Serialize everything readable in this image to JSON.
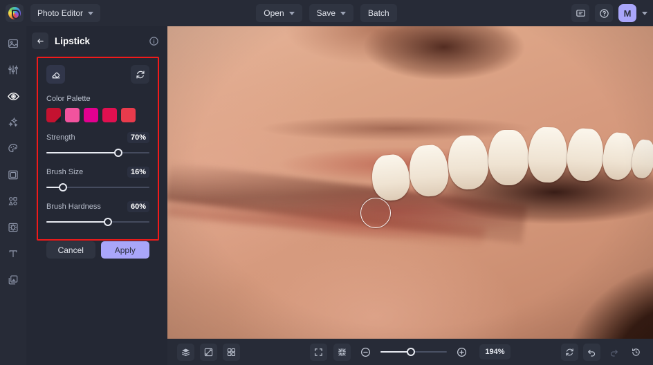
{
  "app": {
    "logo_icon": "color-wheel-logo-icon",
    "switcher_label": "Photo Editor",
    "switcher_chevron_icon": "chevron-down-icon"
  },
  "topbar": {
    "buttons": [
      {
        "label": "Open",
        "icon": "chevron-down-icon",
        "has_chevron": true
      },
      {
        "label": "Save",
        "icon": "chevron-down-icon",
        "has_chevron": true
      },
      {
        "label": "Batch",
        "has_chevron": false
      }
    ],
    "feedback_icon": "chat-bubble-icon",
    "help_icon": "question-circle-icon",
    "avatar_initial": "M",
    "avatar_color": "#a9a6fa",
    "avatar_chevron_icon": "chevron-down-icon"
  },
  "rail": {
    "items": [
      {
        "name": "sidebar-item-image",
        "icon": "image-icon",
        "active": false
      },
      {
        "name": "sidebar-item-adjust",
        "icon": "sliders-icon",
        "active": false
      },
      {
        "name": "sidebar-item-retouch",
        "icon": "eye-icon",
        "active": true
      },
      {
        "name": "sidebar-item-effects",
        "icon": "sparkles-icon",
        "active": false
      },
      {
        "name": "sidebar-item-color",
        "icon": "palette-icon",
        "active": false
      },
      {
        "name": "sidebar-item-frame",
        "icon": "frame-icon",
        "active": false
      },
      {
        "name": "sidebar-item-shapes",
        "icon": "shapes-icon",
        "active": false
      },
      {
        "name": "sidebar-item-sticker",
        "icon": "sticker-icon",
        "active": false
      },
      {
        "name": "sidebar-item-text",
        "icon": "text-icon",
        "active": false
      },
      {
        "name": "sidebar-item-layers",
        "icon": "layers-copy-icon",
        "active": false
      }
    ]
  },
  "panel": {
    "back_icon": "arrow-left-icon",
    "title": "Lipstick",
    "info_icon": "info-circle-icon",
    "eraser_icon": "eraser-icon",
    "reset_icon": "reset-icon",
    "color_palette_label": "Color Palette",
    "swatches": [
      {
        "color": "#c41230",
        "selected": true
      },
      {
        "color": "#f2539e",
        "selected": false
      },
      {
        "color": "#e3008f",
        "selected": false
      },
      {
        "color": "#e01050",
        "selected": false
      },
      {
        "color": "#e93b4c",
        "selected": false
      }
    ],
    "sliders": [
      {
        "name": "Strength",
        "value": "70%",
        "percent": 70
      },
      {
        "name": "Brush Size",
        "value": "16%",
        "percent": 16
      },
      {
        "name": "Brush Hardness",
        "value": "60%",
        "percent": 60
      }
    ],
    "cancel_label": "Cancel",
    "apply_label": "Apply",
    "apply_color": "#a9a6fa",
    "highlight_color": "#f01a1a"
  },
  "canvas": {
    "brush_cursor_icon": "brush-cursor-circle",
    "image_description": "close-up-photo-of-smiling-mouth"
  },
  "bottombar": {
    "left_tools": [
      {
        "name": "layers-button",
        "icon": "layers-stack-icon"
      },
      {
        "name": "compare-button",
        "icon": "compare-split-icon"
      },
      {
        "name": "grid-button",
        "icon": "grid-four-icon"
      }
    ],
    "fit_screen_icon": "fit-screen-icon",
    "fit_actual_icon": "shrink-screen-icon",
    "zoom_out_icon": "minus-circle-icon",
    "zoom_in_icon": "plus-circle-icon",
    "zoom_percent": 45,
    "zoom_label": "194%",
    "right_tools": [
      {
        "name": "reset-view-button",
        "icon": "reset-icon",
        "disabled": false
      },
      {
        "name": "undo-button",
        "icon": "undo-icon",
        "disabled": false
      },
      {
        "name": "redo-button",
        "icon": "redo-icon",
        "disabled": true
      },
      {
        "name": "history-button",
        "icon": "history-icon",
        "disabled": false
      }
    ]
  }
}
